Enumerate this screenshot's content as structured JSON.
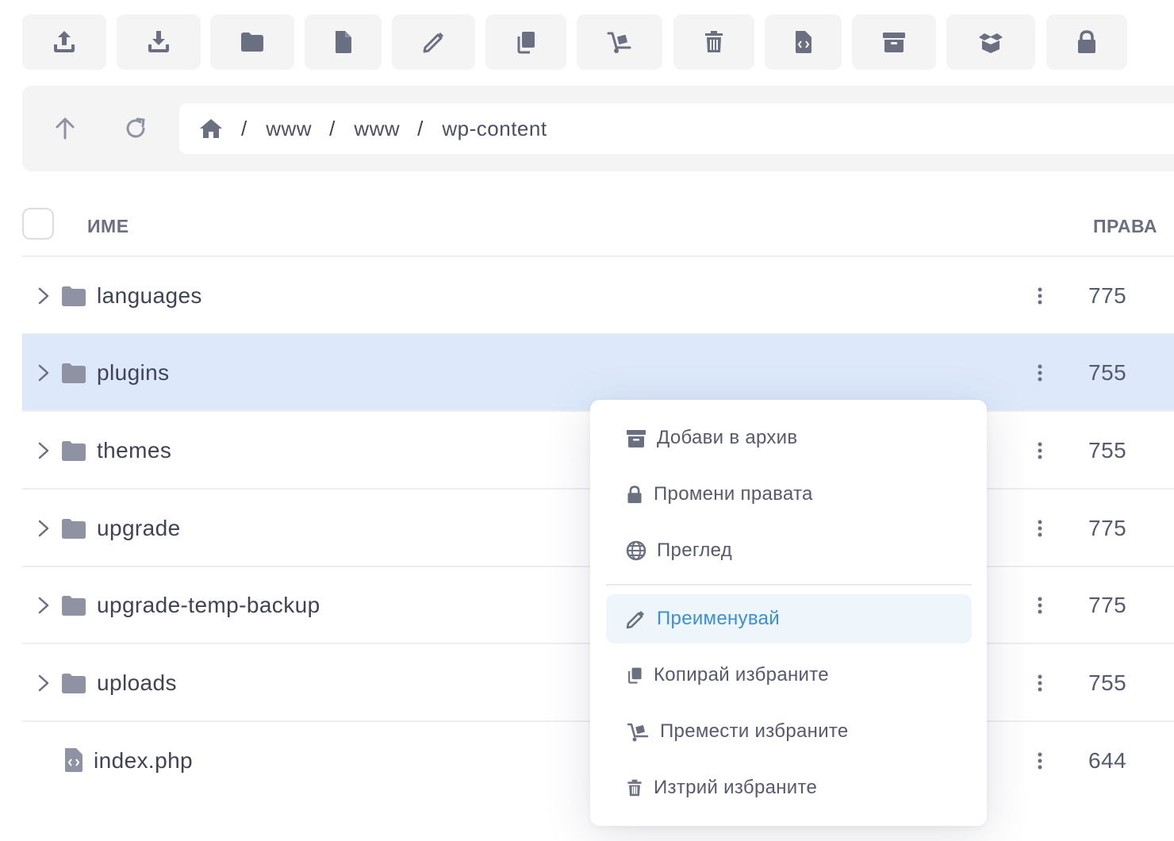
{
  "colors": {
    "icon": "#6b6f82",
    "selected_row": "#dde9fb",
    "accent": "#3b8fd9",
    "toolbar_bg": "#f4f4f5"
  },
  "toolbar": {
    "buttons": [
      {
        "icon": "upload-icon"
      },
      {
        "icon": "download-icon"
      },
      {
        "icon": "new-folder-icon"
      },
      {
        "icon": "new-file-icon"
      },
      {
        "icon": "rename-pencil-icon"
      },
      {
        "icon": "copy-icon"
      },
      {
        "icon": "move-dolly-icon"
      },
      {
        "icon": "trash-icon"
      },
      {
        "icon": "code-file-icon"
      },
      {
        "icon": "archive-icon"
      },
      {
        "icon": "extract-box-icon"
      },
      {
        "icon": "lock-icon"
      }
    ]
  },
  "navigation": {
    "up_icon": "arrow-up-icon",
    "refresh_icon": "refresh-icon",
    "breadcrumb": {
      "home_icon": "home-icon",
      "separator": "/",
      "items": [
        "www",
        "www",
        "wp-content"
      ]
    }
  },
  "table": {
    "headers": {
      "name": "ИМЕ",
      "permissions": "ПРАВА"
    },
    "rows": [
      {
        "type": "folder",
        "name": "languages",
        "permissions": "775",
        "selected": false
      },
      {
        "type": "folder",
        "name": "plugins",
        "permissions": "755",
        "selected": true
      },
      {
        "type": "folder",
        "name": "themes",
        "permissions": "755",
        "selected": false
      },
      {
        "type": "folder",
        "name": "upgrade",
        "permissions": "775",
        "selected": false
      },
      {
        "type": "folder",
        "name": "upgrade-temp-backup",
        "permissions": "775",
        "selected": false
      },
      {
        "type": "folder",
        "name": "uploads",
        "permissions": "755",
        "selected": false
      },
      {
        "type": "file",
        "name": "index.php",
        "permissions": "644",
        "selected": false
      }
    ]
  },
  "context_menu": {
    "items": [
      {
        "label": "Добави в архив",
        "icon": "archive-icon"
      },
      {
        "label": "Промени правата",
        "icon": "lock-icon"
      },
      {
        "label": "Преглед",
        "icon": "globe-icon"
      },
      {
        "label": "Преименувай",
        "icon": "pencil-icon",
        "active": true
      },
      {
        "label": "Копирай избраните",
        "icon": "copy-icon"
      },
      {
        "label": "Премести избраните",
        "icon": "move-dolly-icon"
      },
      {
        "label": "Изтрий избраните",
        "icon": "trash-icon"
      }
    ]
  }
}
